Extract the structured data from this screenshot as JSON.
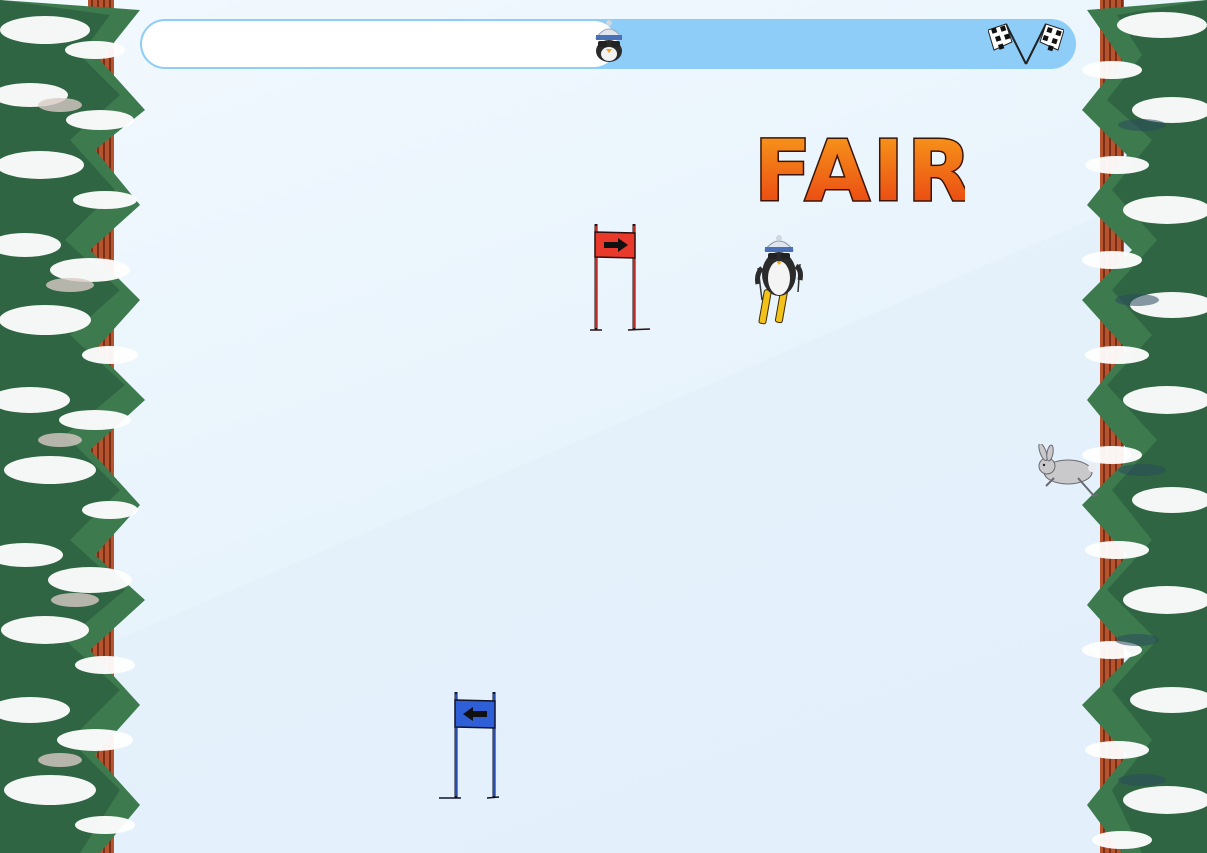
{
  "game": {
    "rating_text": "FAIR",
    "progress_fraction": 0.51
  },
  "icons": {
    "progress_marker": "penguin-head-icon",
    "finish": "checkered-flags-icon",
    "gate_red_direction": "arrow-right-icon",
    "gate_blue_direction": "arrow-left-icon"
  },
  "colors": {
    "snow": "#eaf5fd",
    "progress_track": "#8ecdf7",
    "progress_fill": "#ffffff",
    "gate_red": "#e8392a",
    "gate_blue": "#2f5fd6",
    "rating_top": "#f9a21b",
    "rating_bottom": "#e83a12"
  }
}
